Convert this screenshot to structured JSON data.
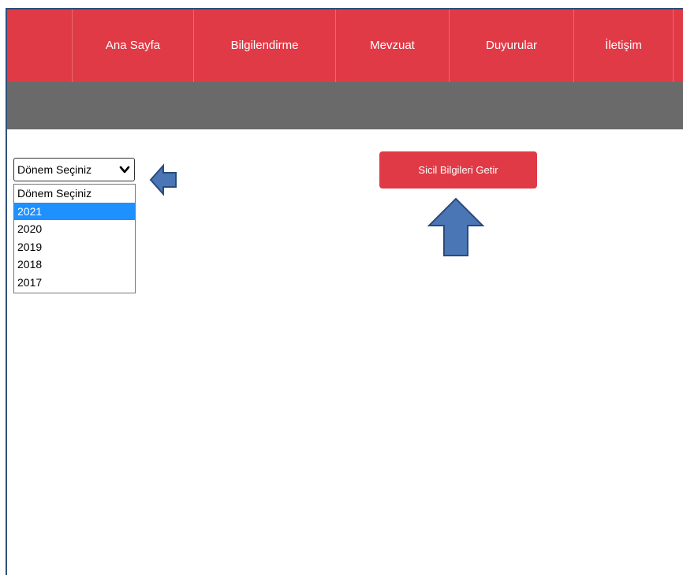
{
  "nav": {
    "items": [
      {
        "label": "Ana Sayfa"
      },
      {
        "label": "Bilgilendirme"
      },
      {
        "label": "Mevzuat"
      },
      {
        "label": "Duyurular"
      },
      {
        "label": "İletişim"
      }
    ]
  },
  "period_select": {
    "selected": "Dönem Seçiniz",
    "options": [
      "Dönem Seçiniz",
      "2021",
      "2020",
      "2019",
      "2018",
      "2017"
    ],
    "highlighted": "2021"
  },
  "action": {
    "button_label": "Sicil Bilgileri Getir"
  },
  "colors": {
    "nav_background": "#e03a46",
    "subbar_background": "#6a6a6a",
    "option_highlight": "#1e90ff",
    "arrow_fill": "#4a76b6",
    "arrow_stroke": "#2b4a7a"
  },
  "icons": [
    "chevron-down-icon",
    "arrow-left-icon",
    "arrow-up-icon"
  ]
}
